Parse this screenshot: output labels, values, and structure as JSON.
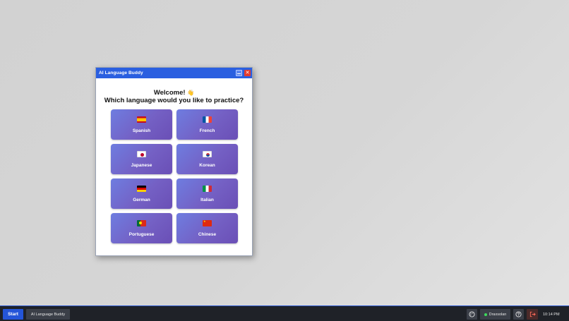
{
  "window": {
    "title": "AI Language Buddy",
    "minimize_label": "–",
    "close_label": "✕"
  },
  "heading": {
    "welcome": "Welcome!",
    "wave_emoji": "👋",
    "question": "Which language would you like to practice?"
  },
  "languages": [
    {
      "label": "Spanish",
      "flag": "es"
    },
    {
      "label": "French",
      "flag": "fr"
    },
    {
      "label": "Japanese",
      "flag": "jp"
    },
    {
      "label": "Korean",
      "flag": "kr"
    },
    {
      "label": "German",
      "flag": "de"
    },
    {
      "label": "Italian",
      "flag": "it"
    },
    {
      "label": "Portuguese",
      "flag": "pt"
    },
    {
      "label": "Chinese",
      "flag": "cn"
    }
  ],
  "taskbar": {
    "start_label": "Start",
    "task_item": "AI Language Buddy",
    "user_name": "Draxsolan",
    "clock": "10:14 PM",
    "icons": [
      "palette-icon",
      "help-icon",
      "logout-icon"
    ]
  },
  "colors": {
    "titlebar": "#2a5fe0",
    "button_gradient_start": "#6e7de0",
    "button_gradient_end": "#6a4fb6",
    "start_button": "#2455d8",
    "status_online": "#3ddc5b"
  }
}
